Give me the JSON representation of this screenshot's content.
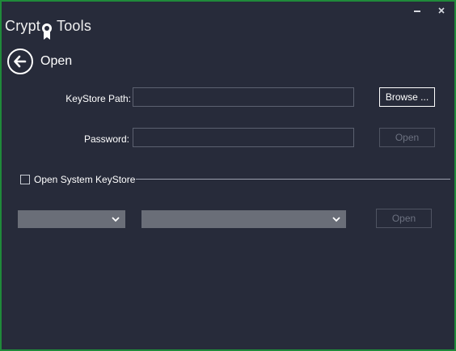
{
  "window": {
    "title_prefix": "Crypt",
    "title_suffix": "Tools",
    "icons": {
      "minimize": "minimize-icon",
      "close": "close-icon"
    }
  },
  "header": {
    "back_icon": "back-arrow-icon",
    "title": "Open"
  },
  "keystore": {
    "path_label": "KeyStore Path:",
    "path_value": "",
    "browse_label": "Browse ...",
    "password_label": "Password:",
    "password_value": "",
    "open_label": "Open"
  },
  "system_keystore": {
    "checkbox_label": "Open System KeyStore",
    "checked": false,
    "select_1_value": "",
    "select_2_value": "",
    "open_label": "Open"
  },
  "colors": {
    "background": "#272b3a",
    "window_border": "#1f8a3a",
    "combo_fill": "#6a6e78",
    "disabled_text": "#6c7180"
  }
}
